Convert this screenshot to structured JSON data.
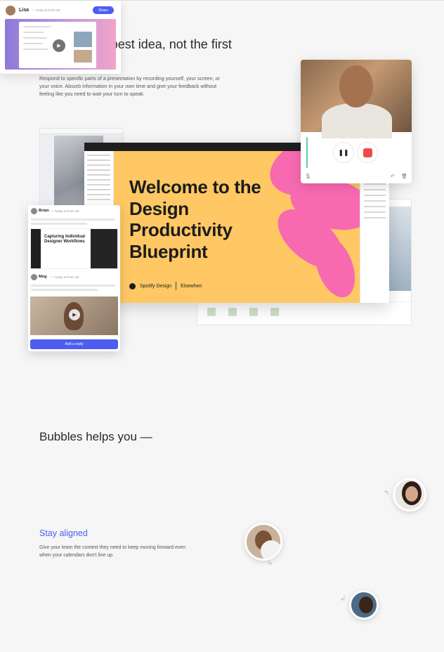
{
  "hero": {
    "title": "Work on the best idea, not the first idea.",
    "subtitle": "Respond to specific parts of a presentation by recording yourself, your screen, or your voice. Absorb information in your own time and give your feedback without feeling like you need to wait your turn to speak."
  },
  "slide": {
    "title": "Welcome to the Design Productivity Blueprint",
    "logo_left": "Spotify Design",
    "logo_right": "Elsewhen"
  },
  "recorder": {
    "pause_glyph": "❚❚",
    "mic_icon": "mic-icon",
    "undo_icon": "undo-icon",
    "trash_icon": "trash-icon",
    "accent": "#ef4a48"
  },
  "comment": {
    "user1": "Brian",
    "user1_meta": "— Today at 8:00 AM",
    "thumb_title": "Capturing Individual Designer Workflows",
    "user2": "Meg",
    "user2_meta": "— Today at 9:00 AM",
    "reply_button": "Add a reply",
    "accent": "#4b5ef0"
  },
  "section2": {
    "heading": "Bubbles helps you —",
    "feature_title": "Stay aligned",
    "feature_text": "Give your team the context they need to keep moving forward even when your calendars don't line up.",
    "card_user": "Lisa",
    "card_meta": "— Today at 8:00 AM",
    "card_share": "Share"
  }
}
